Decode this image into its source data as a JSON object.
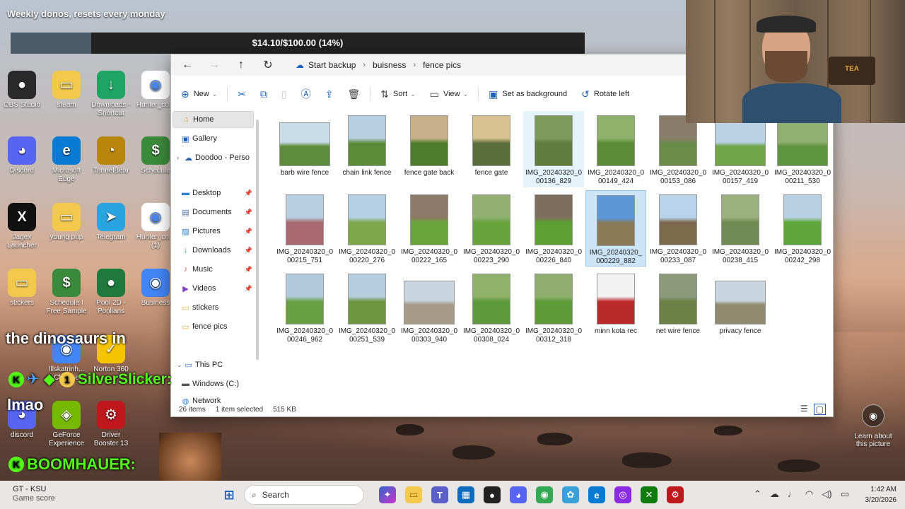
{
  "overlay": {
    "donos_text": "Weekly donos, resets every monday",
    "goal_text": "$14.10/$100.00 (14%)",
    "goal_fraction": 0.14
  },
  "desktop_icons": [
    {
      "label": "OBS Studio",
      "color": "#2a2a2a",
      "glyph": "●"
    },
    {
      "label": "steam",
      "color": "#f2c94c",
      "glyph": "▭"
    },
    {
      "label": "Downloads - Shortcut",
      "color": "#1fa463",
      "glyph": "↓"
    },
    {
      "label": "Hunter_co...",
      "color": "#ffffff",
      "glyph": "◉"
    },
    {
      "label": "Discord",
      "color": "#5865f2",
      "glyph": "◕"
    },
    {
      "label": "Microsoft Edge",
      "color": "#0a7bd4",
      "glyph": "e"
    },
    {
      "label": "TunnelBear",
      "color": "#b8860b",
      "glyph": "◔"
    },
    {
      "label": "Schedule",
      "color": "#3b8a3b",
      "glyph": "$"
    },
    {
      "label": "Jagex Launcher",
      "color": "#111111",
      "glyph": "X"
    },
    {
      "label": "young pup",
      "color": "#f2c94c",
      "glyph": "▭"
    },
    {
      "label": "Telegram",
      "color": "#2aa3e0",
      "glyph": "➤"
    },
    {
      "label": "Hunter_co... (1)",
      "color": "#ffffff",
      "glyph": "◉"
    },
    {
      "label": "stickers",
      "color": "#f2c94c",
      "glyph": "▭"
    },
    {
      "label": "Schedule I Free Sample",
      "color": "#3b8a3b",
      "glyph": "$"
    },
    {
      "label": "Pool 2D - Poolians",
      "color": "#1e7a3c",
      "glyph": "●"
    },
    {
      "label": "Business",
      "color": "#4285f4",
      "glyph": "◉"
    },
    {
      "label": "Illskatrinh... Chrome",
      "color": "#4285f4",
      "glyph": "◉"
    },
    {
      "label": "Norton 360",
      "color": "#f5c400",
      "glyph": "✓"
    },
    {
      "label": "discord",
      "color": "#5865f2",
      "glyph": "◕"
    },
    {
      "label": "GeForce Experience",
      "color": "#76b900",
      "glyph": "◈"
    },
    {
      "label": "Driver Booster 13",
      "color": "#c0171d",
      "glyph": "⚙"
    }
  ],
  "explorer": {
    "nav": {
      "back": "←",
      "forward": "→",
      "up": "↑",
      "refresh": "↻"
    },
    "breadcrumb": [
      "Start backup",
      "buisness",
      "fence pics"
    ],
    "search_stub": "S",
    "toolbar": {
      "new": "New",
      "sort": "Sort",
      "view": "View",
      "set_bg": "Set as background",
      "rotate": "Rotate left"
    },
    "sidebar": [
      {
        "label": "Home",
        "icon": "⌂",
        "color": "#d98a1a",
        "selected": true,
        "pin": false
      },
      {
        "label": "Gallery",
        "icon": "▣",
        "color": "#1d62b8",
        "selected": false,
        "pin": false
      },
      {
        "label": "Doodoo - Perso",
        "icon": "☁",
        "color": "#1d62b8",
        "selected": false,
        "pin": false,
        "caret": "›"
      },
      {
        "label": "Desktop",
        "icon": "▬",
        "color": "#2d7fd3",
        "selected": false,
        "pin": true
      },
      {
        "label": "Documents",
        "icon": "▤",
        "color": "#4a6f9a",
        "selected": false,
        "pin": true
      },
      {
        "label": "Pictures",
        "icon": "▨",
        "color": "#2d7fd3",
        "selected": false,
        "pin": true
      },
      {
        "label": "Downloads",
        "icon": "↓",
        "color": "#1fa463",
        "selected": false,
        "pin": true
      },
      {
        "label": "Music",
        "icon": "♪",
        "color": "#d9534f",
        "selected": false,
        "pin": true
      },
      {
        "label": "Videos",
        "icon": "▶",
        "color": "#7b3fbf",
        "selected": false,
        "pin": true
      },
      {
        "label": "stickers",
        "icon": "▭",
        "color": "#e8b43a",
        "selected": false,
        "pin": false
      },
      {
        "label": "fence pics",
        "icon": "▭",
        "color": "#e8b43a",
        "selected": false,
        "pin": false
      },
      {
        "label": "This PC",
        "icon": "▭",
        "color": "#2d7fd3",
        "selected": false,
        "pin": false,
        "caret": "⌄"
      },
      {
        "label": "Windows (C:)",
        "icon": "▬",
        "color": "#555555",
        "selected": false,
        "pin": false
      },
      {
        "label": "Network",
        "icon": "◍",
        "color": "#2d7fd3",
        "selected": false,
        "pin": false
      }
    ],
    "files": [
      {
        "name": "barb wire fence",
        "sky": "#c9dcea",
        "ground": "#5f8c3c",
        "orient": "land"
      },
      {
        "name": "chain link fence",
        "sky": "#b7cfe0",
        "ground": "#5d8a38",
        "orient": "port"
      },
      {
        "name": "fence gate back",
        "sky": "#c7b08a",
        "ground": "#4f7d2d",
        "orient": "port"
      },
      {
        "name": "fence gate",
        "sky": "#d6c18f",
        "ground": "#5b6f3c",
        "orient": "port"
      },
      {
        "name": "IMG_20240320_000136_829",
        "sky": "#7d9a5d",
        "ground": "#5f7e3e",
        "orient": "port",
        "hover": true
      },
      {
        "name": "IMG_20240320_000149_424",
        "sky": "#8fb26a",
        "ground": "#5c8a36",
        "orient": "port"
      },
      {
        "name": "IMG_20240320_000153_086",
        "sky": "#8a7d6a",
        "ground": "#6a8c48",
        "orient": "port"
      },
      {
        "name": "IMG_20240320_000157_419",
        "sky": "#b9d2e6",
        "ground": "#6fa447",
        "orient": "land"
      },
      {
        "name": "IMG_20240320_000211_530",
        "sky": "#8fb070",
        "ground": "#5f9440",
        "orient": "land"
      },
      {
        "name": "IMG_20240320_000215_751",
        "sky": "#b7cfe0",
        "ground": "#a86a70",
        "orient": "port"
      },
      {
        "name": "IMG_20240320_000220_276",
        "sky": "#b5d0e5",
        "ground": "#7ea64a",
        "orient": "port"
      },
      {
        "name": "IMG_20240320_000222_165",
        "sky": "#8d7a68",
        "ground": "#6aa43a",
        "orient": "port"
      },
      {
        "name": "IMG_20240320_000223_290",
        "sky": "#93b073",
        "ground": "#68a33c",
        "orient": "port"
      },
      {
        "name": "IMG_20240320_000226_840",
        "sky": "#7e6d5d",
        "ground": "#5ea032",
        "orient": "port"
      },
      {
        "name": "IMG_20240320_000229_882",
        "sky": "#5d97d6",
        "ground": "#8a7a58",
        "orient": "port",
        "selected": true
      },
      {
        "name": "IMG_20240320_000233_087",
        "sky": "#b9d3ea",
        "ground": "#7c6a4d",
        "orient": "port"
      },
      {
        "name": "IMG_20240320_000238_415",
        "sky": "#9bb27e",
        "ground": "#6f8a52",
        "orient": "port"
      },
      {
        "name": "IMG_20240320_000242_298",
        "sky": "#b7d0e4",
        "ground": "#5fa63a",
        "orient": "port"
      },
      {
        "name": "IMG_20240320_000246_962",
        "sky": "#b0c9dc",
        "ground": "#66a040",
        "orient": "port"
      },
      {
        "name": "IMG_20240320_000251_539",
        "sky": "#b6cde0",
        "ground": "#6e9540",
        "orient": "port"
      },
      {
        "name": "IMG_20240320_000303_940",
        "sky": "#c9d6e0",
        "ground": "#a79a86",
        "orient": "land"
      },
      {
        "name": "IMG_20240320_000308_024",
        "sky": "#8fb26a",
        "ground": "#5f9a3a",
        "orient": "port"
      },
      {
        "name": "IMG_20240320_000312_318",
        "sky": "#8fae6e",
        "ground": "#5e9a38",
        "orient": "port"
      },
      {
        "name": "minn kota rec",
        "sky": "#f2f2f2",
        "ground": "#bb2a2a",
        "orient": "port"
      },
      {
        "name": "net wire fence",
        "sky": "#8a9a7a",
        "ground": "#6a8044",
        "orient": "port"
      },
      {
        "name": "privacy fence",
        "sky": "#c8d6e2",
        "ground": "#8e8a6e",
        "orient": "land"
      }
    ],
    "status": {
      "count": "26 items",
      "selected": "1 item selected",
      "size": "515 KB"
    }
  },
  "chat": {
    "line1": "the dinosaurs in",
    "user1": "SilverSlicker:",
    "line2": "lmao",
    "user2": "BOOMHAUER:"
  },
  "learn": "Learn about this picture",
  "taskbar": {
    "weather_title": "GT - KSU",
    "weather_sub": "Game score",
    "search": "Search",
    "time": "1:42 AM",
    "date": "3/20/2026"
  }
}
